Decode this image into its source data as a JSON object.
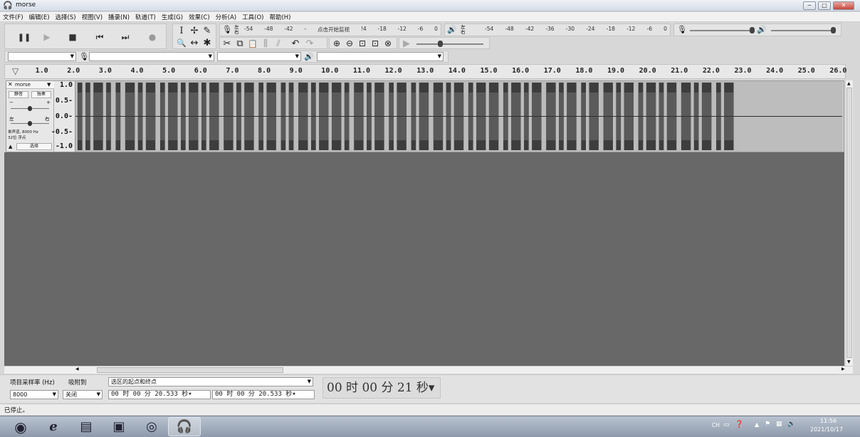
{
  "window": {
    "title": "morse",
    "controls": [
      "─",
      "□",
      "✕"
    ]
  },
  "menu": [
    "文件(F)",
    "编辑(E)",
    "选择(S)",
    "视图(V)",
    "播录(N)",
    "轨道(T)",
    "生成(G)",
    "效果(C)",
    "分析(A)",
    "工具(O)",
    "帮助(H)"
  ],
  "transport": {
    "pause": "❚❚",
    "play": "▶",
    "stop": "■",
    "skip_start": "⏮",
    "skip_end": "⏭",
    "record": "●"
  },
  "tools": {
    "row1": [
      "I",
      "✢",
      "✎"
    ],
    "row2": [
      "🔍",
      "↔",
      "✱"
    ]
  },
  "record_meter": {
    "lr": "左\n右",
    "scale": [
      "-54",
      "-48",
      "-42",
      "-",
      "点击开始监视",
      "!4",
      "-18",
      "-12",
      "-6",
      "0"
    ]
  },
  "play_meter": {
    "lr": "左\n右",
    "scale": [
      "-54",
      "-48",
      "-42",
      "-36",
      "-30",
      "-24",
      "-18",
      "-12",
      "-6",
      "0"
    ]
  },
  "edit_tools": [
    "✂",
    "⧉",
    "📋",
    "⫼",
    "⫽",
    "↶",
    "↷",
    "⊕",
    "⊖",
    "⊡",
    "⊡",
    "⊗",
    "▶"
  ],
  "device_bar": {
    "host": "",
    "mic": "",
    "channels": "",
    "speaker": ""
  },
  "ruler": {
    "ticks": [
      "1.0",
      "2.0",
      "3.0",
      "4.0",
      "5.0",
      "6.0",
      "7.0",
      "8.0",
      "9.0",
      "10.0",
      "11.0",
      "12.0",
      "13.0",
      "14.0",
      "15.0",
      "16.0",
      "17.0",
      "18.0",
      "19.0",
      "20.0",
      "21.0",
      "22.0",
      "23.0",
      "24.0",
      "25.0",
      "26.0"
    ]
  },
  "track": {
    "name": "morse",
    "mute": "静音",
    "solo": "独奏",
    "pan_left": "左",
    "pan_right": "右",
    "gain_minus": "−",
    "gain_plus": "+",
    "info_line1": "单声道, 8000 Hz",
    "info_line2": "32位 浮点",
    "select": "选择",
    "collapse": "▲",
    "close": "✕",
    "menu_arrow": "▼",
    "scale": [
      "1.0",
      "0.5-",
      "0.0-",
      "-0.5-",
      "-1.0"
    ],
    "waveform_start_seconds": 0.2,
    "waveform_end_seconds": 21.0,
    "pulses": [
      [
        0.2,
        0.35
      ],
      [
        0.45,
        0.6
      ],
      [
        0.7,
        1.0
      ],
      [
        1.1,
        1.25
      ],
      [
        1.4,
        1.55
      ],
      [
        1.7,
        2.0
      ],
      [
        2.1,
        2.25
      ],
      [
        2.35,
        2.65
      ],
      [
        2.8,
        2.95
      ],
      [
        3.05,
        3.35
      ],
      [
        3.45,
        3.6
      ],
      [
        3.7,
        4.0
      ],
      [
        4.1,
        4.25
      ],
      [
        4.35,
        4.65
      ],
      [
        4.8,
        5.1
      ],
      [
        5.2,
        5.35
      ],
      [
        5.45,
        5.75
      ],
      [
        5.9,
        6.05
      ],
      [
        6.15,
        6.45
      ],
      [
        6.6,
        6.75
      ],
      [
        6.85,
        7.0
      ],
      [
        7.15,
        7.45
      ],
      [
        7.55,
        7.7
      ],
      [
        7.8,
        8.1
      ],
      [
        8.2,
        8.5
      ],
      [
        8.6,
        8.75
      ],
      [
        8.9,
        9.2
      ],
      [
        9.3,
        9.45
      ],
      [
        9.55,
        9.85
      ],
      [
        10.0,
        10.15
      ],
      [
        10.25,
        10.55
      ],
      [
        10.7,
        10.85
      ],
      [
        10.95,
        11.25
      ],
      [
        11.4,
        11.7
      ],
      [
        11.8,
        11.95
      ],
      [
        12.05,
        12.35
      ],
      [
        12.5,
        12.65
      ],
      [
        12.75,
        13.05
      ],
      [
        13.15,
        13.45
      ],
      [
        13.6,
        13.75
      ],
      [
        13.85,
        14.15
      ],
      [
        14.25,
        14.4
      ],
      [
        14.5,
        14.8
      ],
      [
        14.95,
        15.25
      ],
      [
        15.35,
        15.5
      ],
      [
        15.6,
        15.9
      ],
      [
        16.05,
        16.2
      ],
      [
        16.3,
        16.6
      ],
      [
        16.75,
        17.05
      ],
      [
        17.15,
        17.3
      ],
      [
        17.4,
        17.7
      ],
      [
        17.85,
        18.0
      ],
      [
        18.1,
        18.4
      ],
      [
        18.5,
        18.65
      ],
      [
        18.75,
        19.05
      ],
      [
        19.2,
        19.5
      ],
      [
        19.6,
        19.75
      ],
      [
        19.85,
        20.15
      ],
      [
        20.3,
        20.45
      ],
      [
        20.55,
        20.85
      ]
    ]
  },
  "bottom": {
    "rate_label": "项目采样率 (Hz)",
    "snap_label": "吸附到",
    "rate_value": "8000",
    "snap_value": "关闭",
    "selection_mode": "选区的起点和终点",
    "sel_start": "00 时 00 分 20.533 秒▾",
    "sel_end": "00 时 00 分 20.533 秒▾",
    "audio_position": "00 时 00 分 21 秒▾"
  },
  "status": "已停止。",
  "taskbar": {
    "lang": "CH",
    "time": "11:56",
    "date": "2021/10/17"
  }
}
